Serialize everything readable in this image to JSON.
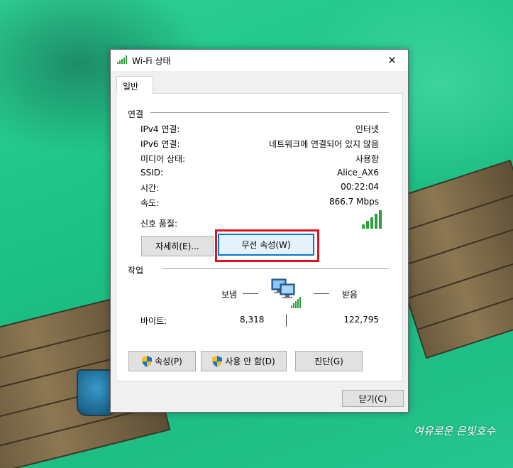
{
  "window": {
    "title": "Wi-Fi 상태",
    "close_glyph": "✕"
  },
  "tabs": [
    {
      "label": "일반",
      "selected": true
    }
  ],
  "connection": {
    "section_label": "연결",
    "rows": [
      {
        "label": "IPv4 연결:",
        "value": "인터넷"
      },
      {
        "label": "IPv6 연결:",
        "value": "네트워크에 연결되어 있지 않음"
      },
      {
        "label": "미디어 상태:",
        "value": "사용함"
      },
      {
        "label": "SSID:",
        "value": "Alice_AX6"
      },
      {
        "label": "시간:",
        "value": "00:22:04"
      },
      {
        "label": "속도:",
        "value": "866.7 Mbps"
      }
    ],
    "signal_label": "신호 품질:",
    "signal_bars_filled": 5,
    "signal_bars_total": 5,
    "details_button": "자세히(E)...",
    "wireless_props_button": "무선 속성(W)"
  },
  "activity": {
    "section_label": "작업",
    "sent_label": "보냄",
    "received_label": "받음",
    "bytes_label": "바이트:",
    "bytes_sent": "8,318",
    "bytes_received": "122,795",
    "properties_button": "속성(P)",
    "disable_button": "사용 안 함(D)",
    "diagnose_button": "진단(G)"
  },
  "footer": {
    "close_button": "닫기(C)"
  },
  "wallpaper": {
    "watermark": "여유로운 은빛호수"
  },
  "colors": {
    "highlight_box": "#e3101d",
    "focus_border": "#0078d7",
    "signal_green": "#2e9e3e"
  },
  "icons": {
    "title": "wifi-signal-icon",
    "signal": "signal-strength-icon",
    "network": "network-computers-icon",
    "uac": "uac-shield-icon"
  }
}
